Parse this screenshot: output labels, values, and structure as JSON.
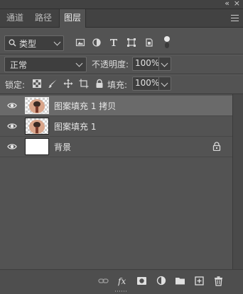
{
  "panel": {
    "tabs": [
      {
        "label": "通道"
      },
      {
        "label": "路径"
      },
      {
        "label": "图层",
        "active": true
      }
    ]
  },
  "filter": {
    "kind_label": "类型"
  },
  "blend": {
    "mode": "正常",
    "opacity_label": "不透明度:",
    "opacity_value": "100%"
  },
  "lock": {
    "label": "锁定:",
    "fill_label": "填充:",
    "fill_value": "100%"
  },
  "layers": [
    {
      "name": "图案填充 1 拷贝",
      "selected": true,
      "thumb": "pattern"
    },
    {
      "name": "图案填充 1",
      "selected": false,
      "thumb": "pattern"
    },
    {
      "name": "背景",
      "selected": false,
      "thumb": "white",
      "locked": true
    }
  ],
  "colors": {
    "panel_bg": "#535353",
    "selected_layer_bg": "#6a6a6a"
  }
}
